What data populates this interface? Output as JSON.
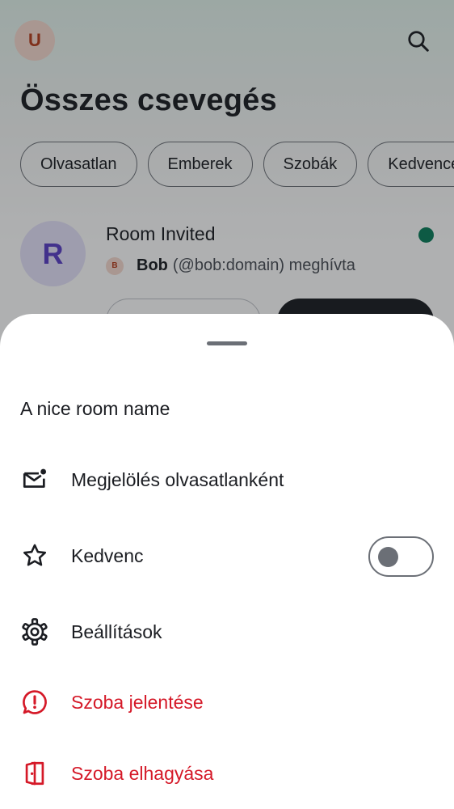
{
  "header": {
    "user_avatar_letter": "U",
    "title": "Összes csevegés",
    "search_icon": "search-icon"
  },
  "filters": [
    "Olvasatlan",
    "Emberek",
    "Szobák",
    "Kedvencek"
  ],
  "room_list": {
    "invite": {
      "avatar_letter": "R",
      "name": "Room Invited",
      "inviter_avatar_letter": "B",
      "inviter_name": "Bob",
      "inviter_rest": "(@bob:domain) meghívta",
      "unread_color": "#0a7d5a"
    }
  },
  "sheet": {
    "title": "A nice room name",
    "items": [
      {
        "label": "Megjelölés olvasatlanként",
        "icon": "mark-unread-icon",
        "danger": false
      },
      {
        "label": "Kedvenc",
        "icon": "star-icon",
        "danger": false,
        "toggle": false
      },
      {
        "label": "Beállítások",
        "icon": "settings-gear-icon",
        "danger": false
      },
      {
        "label": "Szoba jelentése",
        "icon": "report-icon",
        "danger": true
      },
      {
        "label": "Szoba elhagyása",
        "icon": "leave-room-icon",
        "danger": true
      }
    ]
  },
  "colors": {
    "danger": "#d51928",
    "accent": "#0a7d5a",
    "text": "#1b1d22"
  }
}
